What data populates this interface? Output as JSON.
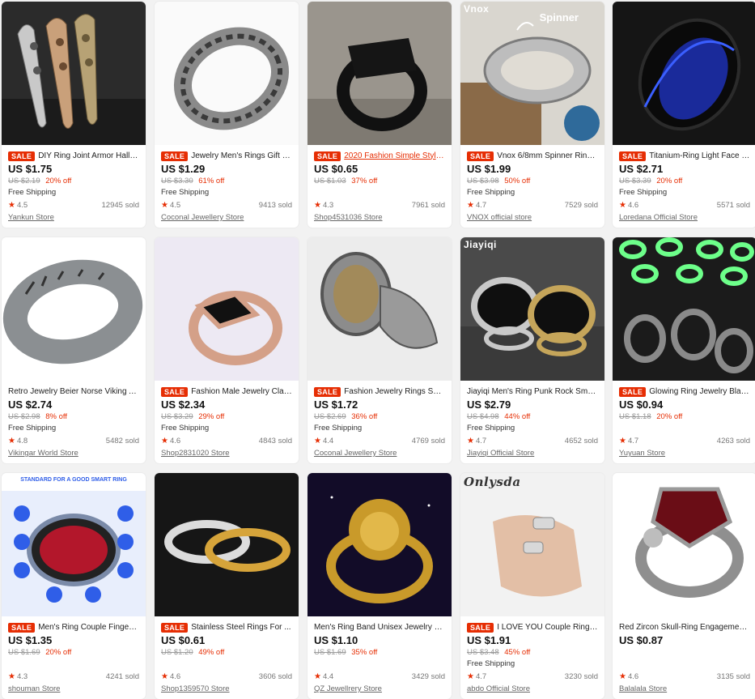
{
  "products": [
    {
      "sale": "SALE",
      "title": "DIY Ring Joint Armor Hallo...",
      "price": "US $1.75",
      "original": "US $2.19",
      "discount": "20% off",
      "shipping": "Free Shipping",
      "rating": "4.5",
      "sold": "12945 sold",
      "store": "Yankun Store",
      "icon": "armor-finger-ring-photo"
    },
    {
      "sale": "SALE",
      "title": "Jewelry Men's Rings Gift M...",
      "price": "US $1.29",
      "original": "US $3.30",
      "discount": "61% off",
      "shipping": "Free Shipping",
      "rating": "4.5",
      "sold": "9413 sold",
      "store": "Coconal Jewellery Store",
      "icon": "eye-pattern-ring-photo"
    },
    {
      "sale": "SALE",
      "title": "2020 Fashion Simple Style...",
      "price": "US $0.65",
      "original": "US $1.03",
      "discount": "37% off",
      "shipping": "",
      "rating": "4.3",
      "sold": "7961 sold",
      "store": "Shop4531036 Store",
      "icon": "black-signet-ring-photo"
    },
    {
      "sale": "SALE",
      "title": "Vnox 6/8mm Spinner Ring...",
      "price": "US $1.99",
      "original": "US $3.98",
      "discount": "50% off",
      "shipping": "Free Shipping",
      "rating": "4.7",
      "sold": "7529 sold",
      "store": "VNOX official store",
      "watermark": "Vnox",
      "overlay": "Spinner",
      "icon": "spinner-ring-photo"
    },
    {
      "sale": "SALE",
      "title": "Titanium-Ring Light Face S...",
      "price": "US $2.71",
      "original": "US $3.39",
      "discount": "20% off",
      "shipping": "Free Shipping",
      "rating": "4.6",
      "sold": "5571 sold",
      "store": "Loredana Official Store",
      "icon": "blue-groove-ring-photo"
    },
    {
      "sale": "",
      "title": "Retro Jewelry Beier Norse Viking A...",
      "price": "US $2.74",
      "original": "US $2.98",
      "discount": "8% off",
      "shipping": "Free Shipping",
      "rating": "4.8",
      "sold": "5482 sold",
      "store": "Vikingar World Store",
      "icon": "rune-ring-photo"
    },
    {
      "sale": "SALE",
      "title": "Fashion Male Jewelry Clas...",
      "price": "US $2.34",
      "original": "US $3.29",
      "discount": "29% off",
      "shipping": "Free Shipping",
      "rating": "4.6",
      "sold": "4843 sold",
      "store": "Shop2831020 Store",
      "icon": "rose-gold-onyx-ring-photo"
    },
    {
      "sale": "SALE",
      "title": "Fashion Jewelry Rings Sold...",
      "price": "US $1.72",
      "original": "US $2.69",
      "discount": "36% off",
      "shipping": "Free Shipping",
      "rating": "4.4",
      "sold": "4769 sold",
      "store": "Coconal Jewellery Store",
      "icon": "engraved-signet-ring-photo"
    },
    {
      "sale": "",
      "title": "Jiayiqi Men's Ring Punk Rock Smoo...",
      "price": "US $2.79",
      "original": "US $4.98",
      "discount": "44% off",
      "shipping": "Free Shipping",
      "rating": "4.7",
      "sold": "4652 sold",
      "store": "Jiayiqi Official Store",
      "watermark": "Jiayiqi",
      "icon": "black-stone-rings-photo"
    },
    {
      "sale": "SALE",
      "title": "Glowing Ring Jewelry Blac...",
      "price": "US $0.94",
      "original": "US $1.18",
      "discount": "20% off",
      "shipping": "",
      "rating": "4.7",
      "sold": "4263 sold",
      "store": "Yuyuan Store",
      "icon": "glowing-rings-photo"
    },
    {
      "sale": "SALE",
      "title": "Men's Ring Couple Finger ...",
      "price": "US $1.35",
      "original": "US $1.69",
      "discount": "20% off",
      "shipping": "",
      "rating": "4.3",
      "sold": "4241 sold",
      "store": "shouman Store",
      "overlay": "STANDARD FOR A GOOD SMART RING",
      "icon": "smart-ring-photo"
    },
    {
      "sale": "SALE",
      "title": "Stainless Steel Rings For ...",
      "price": "US $0.61",
      "original": "US $1.20",
      "discount": "49% off",
      "shipping": "",
      "rating": "4.6",
      "sold": "3606 sold",
      "store": "Shop1359570 Store",
      "icon": "silver-gold-bands-photo"
    },
    {
      "sale": "",
      "title": "Men's Ring Band Unisex Jewelry C...",
      "price": "US $1.10",
      "original": "US $1.69",
      "discount": "35% off",
      "shipping": "",
      "rating": "4.4",
      "sold": "3429 sold",
      "store": "QZ Jewellrery Store",
      "icon": "gold-lion-ring-photo"
    },
    {
      "sale": "SALE",
      "title": "I LOVE YOU Couple Rings ...",
      "price": "US $1.91",
      "original": "US $3.48",
      "discount": "45% off",
      "shipping": "Free Shipping",
      "rating": "4.7",
      "sold": "3230 sold",
      "store": "abdo Official Store",
      "watermark": "Onlysda",
      "icon": "rings-on-hand-photo"
    },
    {
      "sale": "",
      "title": "Red Zircon Skull-Ring Engagement-...",
      "price": "US $0.87",
      "original": "",
      "discount": "",
      "shipping": "",
      "rating": "4.6",
      "sold": "3135 sold",
      "store": "Balalala Store",
      "icon": "skull-coffin-ring-photo"
    }
  ],
  "colors": {
    "accent": "#e62e04",
    "star": "#e62e04"
  }
}
